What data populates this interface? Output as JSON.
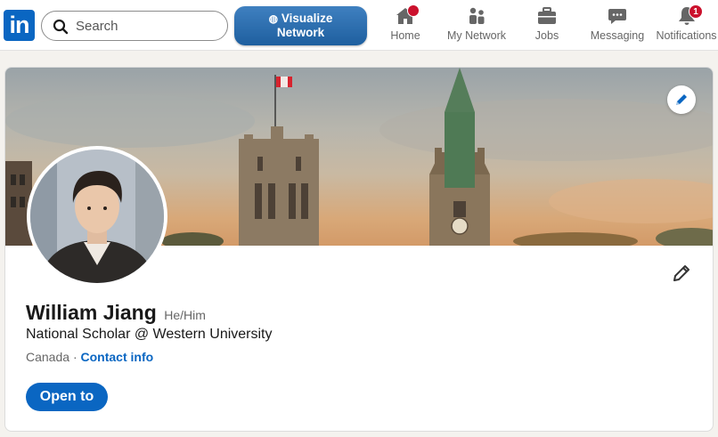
{
  "nav": {
    "logo_text": "in",
    "search_placeholder": "Search",
    "visualize_line1": "Visualize",
    "visualize_line2": "Network",
    "items": [
      {
        "label": "Home",
        "icon": "home-icon"
      },
      {
        "label": "My Network",
        "icon": "people-icon"
      },
      {
        "label": "Jobs",
        "icon": "briefcase-icon"
      },
      {
        "label": "Messaging",
        "icon": "chat-icon"
      },
      {
        "label": "Notifications",
        "icon": "bell-icon",
        "badge": "1"
      }
    ]
  },
  "profile": {
    "name": "William Jiang",
    "pronouns": "He/Him",
    "headline": "National Scholar @ Western University",
    "location": "Canada",
    "separator": "·",
    "contact_label": "Contact info",
    "open_to_label": "Open to"
  },
  "colors": {
    "brand": "#0a66c2",
    "badge": "#cb112d"
  }
}
